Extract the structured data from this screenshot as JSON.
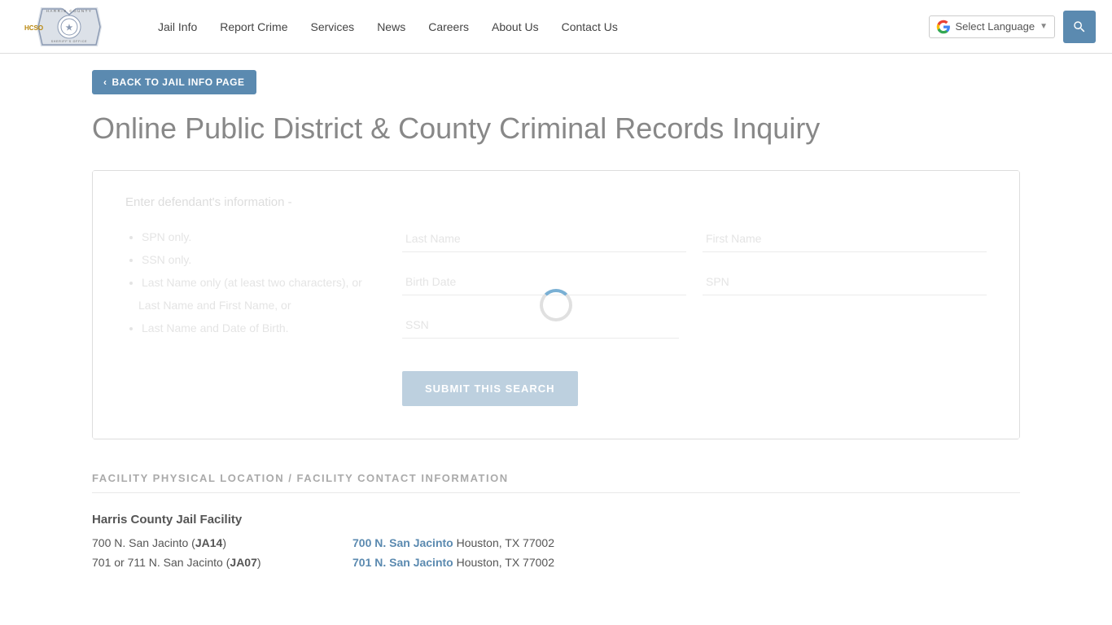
{
  "header": {
    "logo_alt": "Harris County Sheriff's Office",
    "nav_items": [
      {
        "label": "Jail Info",
        "href": "#"
      },
      {
        "label": "Report Crime",
        "href": "#"
      },
      {
        "label": "Services",
        "href": "#"
      },
      {
        "label": "News",
        "href": "#"
      },
      {
        "label": "Careers",
        "href": "#"
      },
      {
        "label": "About Us",
        "href": "#"
      },
      {
        "label": "Contact Us",
        "href": "#"
      }
    ],
    "translate_label": "Select Language",
    "search_aria": "Search"
  },
  "back_button": "BACK TO JAIL INFO PAGE",
  "page_title": "Online Public District & County Criminal Records Inquiry",
  "form": {
    "label": "Enter defendant's information -",
    "instructions": [
      "SPN only.",
      "SSN only.",
      "Last Name only (at least two characters), or",
      "Last Name and First Name, or",
      "Last Name and Date of Birth."
    ],
    "fields": {
      "last_name_placeholder": "Last Name",
      "first_name_placeholder": "First Name",
      "birth_date_placeholder": "Birth Date",
      "spn_placeholder": "SPN",
      "ssn_placeholder": "SSN"
    },
    "submit_label": "SUBMIT THIS SEARCH"
  },
  "facility_section": {
    "title": "FACILITY PHYSICAL LOCATION / FACILITY CONTACT INFORMATION",
    "facilities": [
      {
        "name": "Harris County Jail Facility",
        "rows": [
          {
            "left": "700 N. San Jacinto (",
            "code": "JA14",
            "left_end": ")",
            "link_text": "700 N. San Jacinto",
            "right_rest": " Houston, TX 77002"
          },
          {
            "left": "701 or 711 N. San Jacinto (",
            "code": "JA07",
            "left_end": ")",
            "link_text": "701 N. San Jacinto",
            "right_rest": " Houston, TX 77002"
          }
        ]
      }
    ]
  }
}
